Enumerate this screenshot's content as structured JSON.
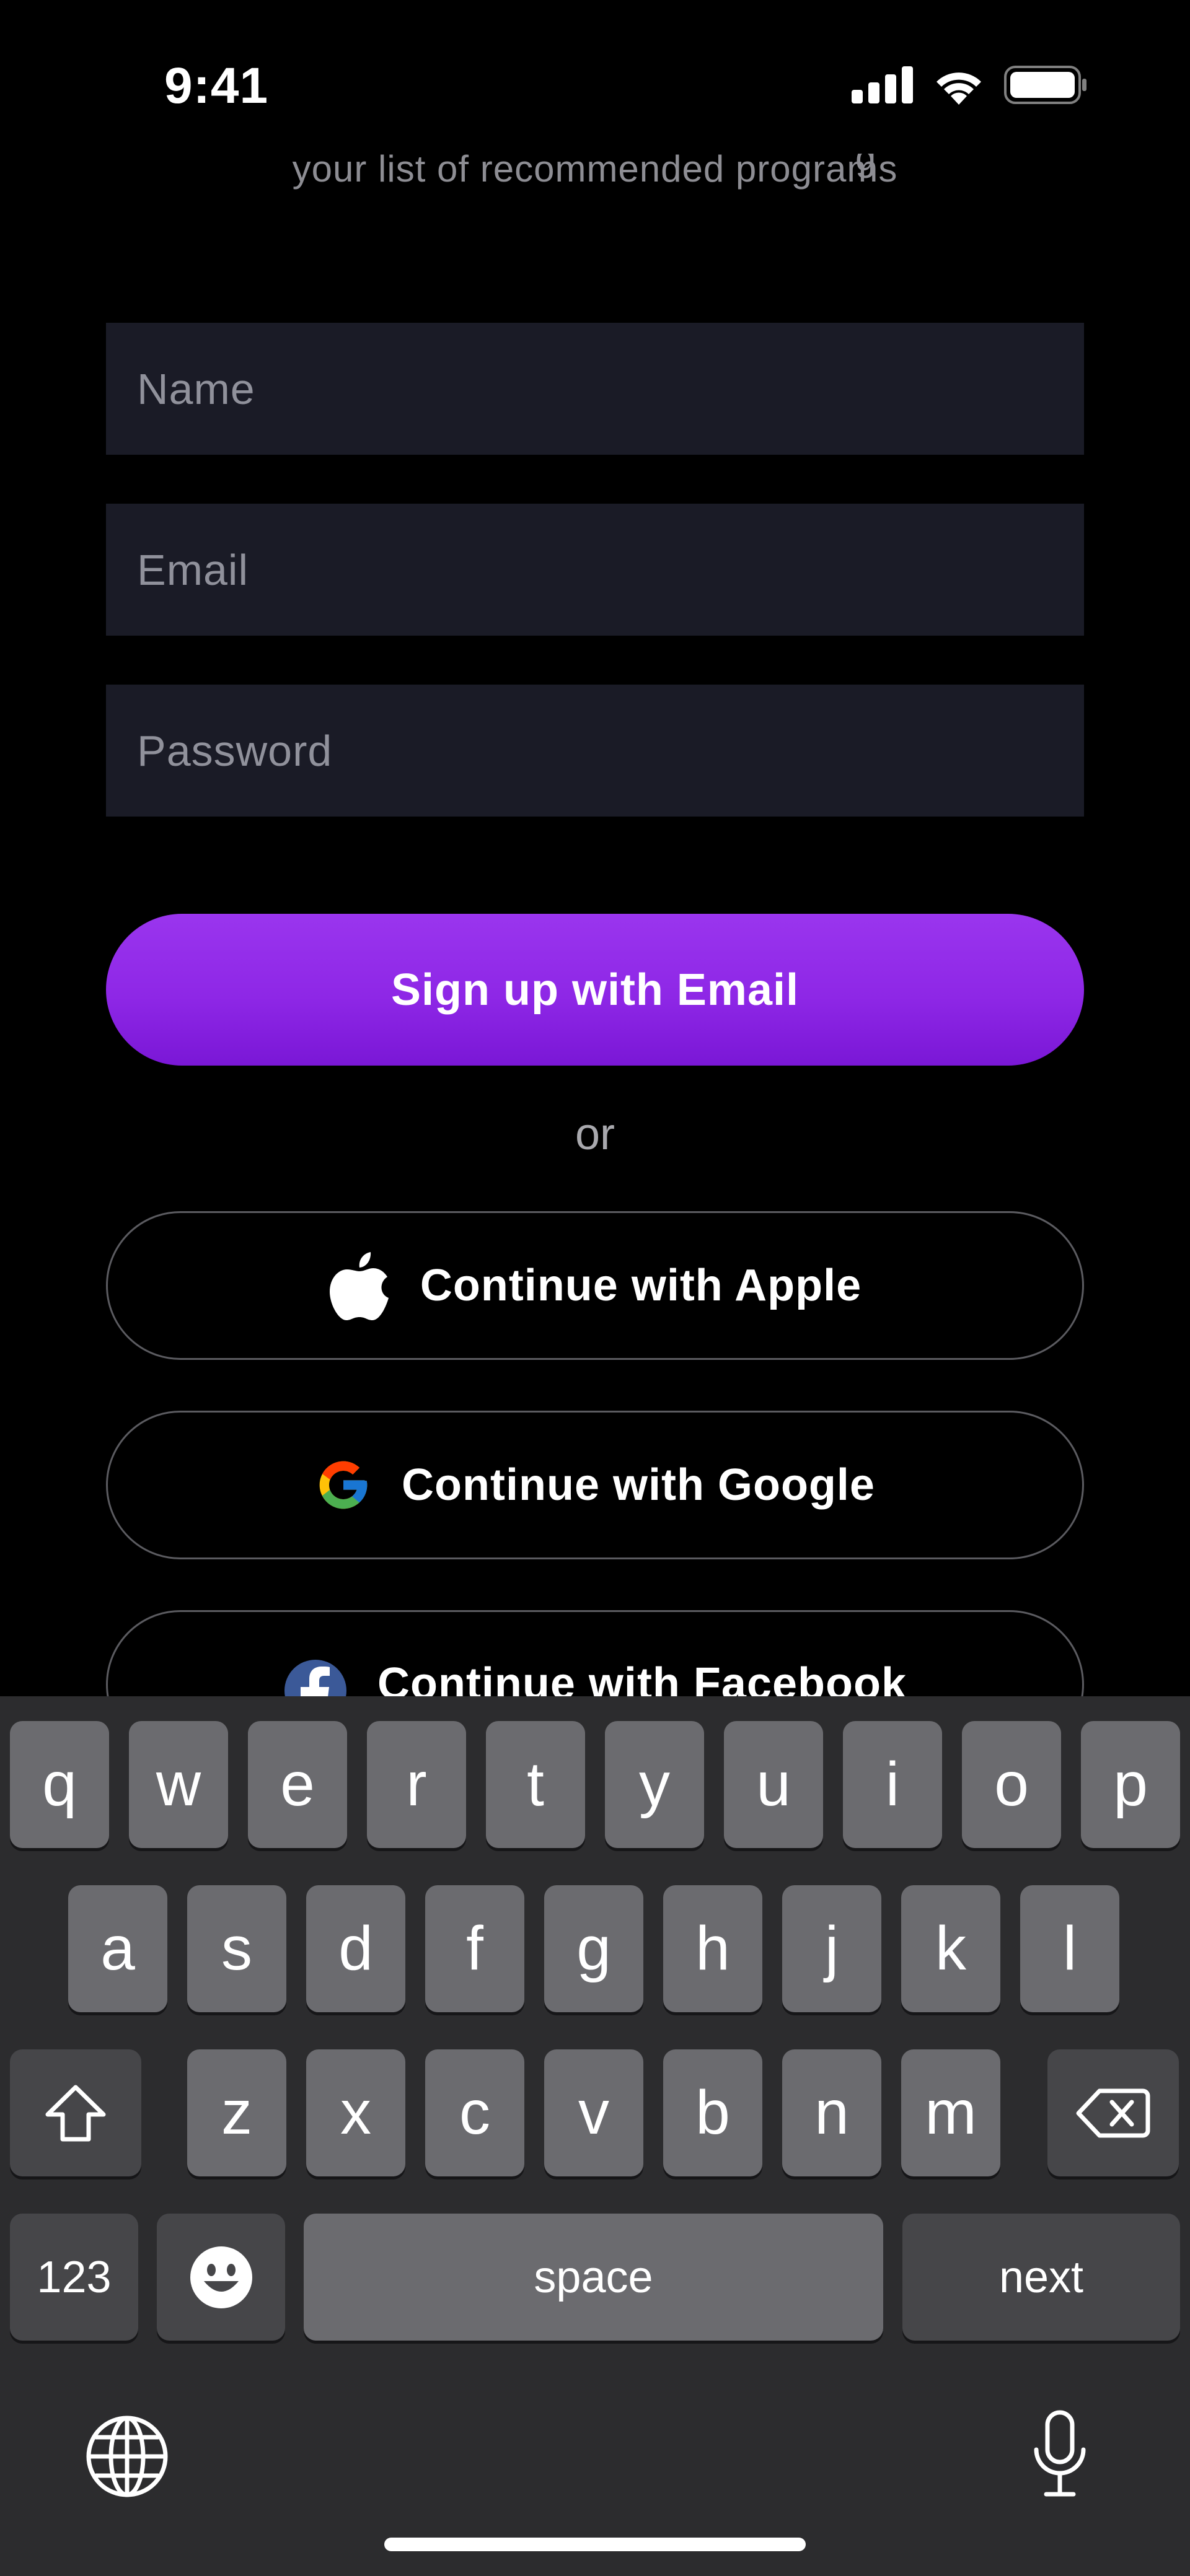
{
  "status_bar": {
    "time": "9:41"
  },
  "subtitle": {
    "visible_line": "your list of recommended programs",
    "clipped_fragment": "g"
  },
  "form": {
    "name_placeholder": "Name",
    "email_placeholder": "Email",
    "password_placeholder": "Password"
  },
  "buttons": {
    "sign_up_email": "Sign up with Email",
    "or": "or",
    "apple": "Continue with Apple",
    "google": "Continue with Google",
    "facebook": "Continue with Facebook"
  },
  "keyboard": {
    "row1": [
      "q",
      "w",
      "e",
      "r",
      "t",
      "y",
      "u",
      "i",
      "o",
      "p"
    ],
    "row2": [
      "a",
      "s",
      "d",
      "f",
      "g",
      "h",
      "j",
      "k",
      "l"
    ],
    "row3": [
      "z",
      "x",
      "c",
      "v",
      "b",
      "n",
      "m"
    ],
    "numbers_key": "123",
    "space_key": "space",
    "next_key": "next"
  },
  "colors": {
    "background": "#000000",
    "field_bg": "#1a1b26",
    "accent_purple": "#8e27e6",
    "keyboard_bg": "#2c2c2e",
    "key_bg": "#6b6b6f"
  }
}
